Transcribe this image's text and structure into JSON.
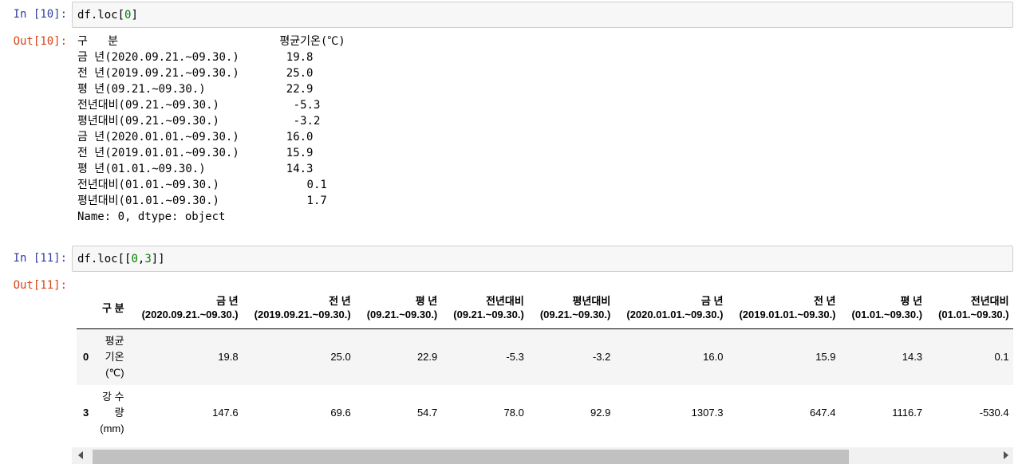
{
  "cells": [
    {
      "in_prompt": "In [10]:",
      "code_prefix": "df.loc[",
      "code_number": "0",
      "code_suffix": "]",
      "out_prompt": "Out[10]:",
      "output_text": "구   분                        평균기온(℃)\n금 년(2020.09.21.~09.30.)       19.8\n전 년(2019.09.21.~09.30.)       25.0\n평 년(09.21.~09.30.)            22.9\n전년대비(09.21.~09.30.)           -5.3\n평년대비(09.21.~09.30.)           -3.2\n금 년(2020.01.01.~09.30.)       16.0\n전 년(2019.01.01.~09.30.)       15.9\n평 년(01.01.~09.30.)            14.3\n전년대비(01.01.~09.30.)             0.1\n평년대비(01.01.~09.30.)             1.7\nName: 0, dtype: object"
    },
    {
      "in_prompt": "In [11]:",
      "code_prefix": "df.loc[[",
      "code_number1": "0",
      "code_comma": ",",
      "code_number2": "3",
      "code_suffix": "]]",
      "out_prompt": "Out[11]:"
    }
  ],
  "table": {
    "index_name": "구 분",
    "columns": [
      {
        "line1": "금 년",
        "line2": "(2020.09.21.~09.30.)"
      },
      {
        "line1": "전 년",
        "line2": "(2019.09.21.~09.30.)"
      },
      {
        "line1": "평 년",
        "line2": "(09.21.~09.30.)"
      },
      {
        "line1": "전년대비",
        "line2": "(09.21.~09.30.)"
      },
      {
        "line1": "평년대비",
        "line2": "(09.21.~09.30.)"
      },
      {
        "line1": "금 년",
        "line2": "(2020.01.01.~09.30.)"
      },
      {
        "line1": "전 년",
        "line2": "(2019.01.01.~09.30.)"
      },
      {
        "line1": "평 년",
        "line2": "(01.01.~09.30.)"
      },
      {
        "line1": "전년대비",
        "line2": "(01.01.~09.30.)"
      }
    ],
    "rows": [
      {
        "idx": "0",
        "label_lines": [
          "평균",
          "기온",
          "(℃)"
        ],
        "values": [
          "19.8",
          "25.0",
          "22.9",
          "-5.3",
          "-3.2",
          "16.0",
          "15.9",
          "14.3",
          "0.1"
        ]
      },
      {
        "idx": "3",
        "label_lines": [
          "강 수",
          "량",
          "(mm)"
        ],
        "values": [
          "147.6",
          "69.6",
          "54.7",
          "78.0",
          "92.9",
          "1307.3",
          "647.4",
          "1116.7",
          "-530.4"
        ]
      }
    ]
  },
  "scrollbar": {
    "visible_fraction": 0.84
  }
}
